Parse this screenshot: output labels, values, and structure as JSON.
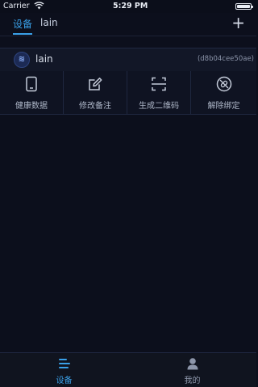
{
  "status_bar": {
    "carrier": "Carrier",
    "time": "5:29 PM"
  },
  "tabs": [
    {
      "label": "设备"
    },
    {
      "label": "lain"
    }
  ],
  "header": {
    "add_label": "+"
  },
  "device": {
    "avatar_text": "≋",
    "name": "lain",
    "id": "(d8b04cee50ae)"
  },
  "actions": [
    {
      "label": "健康数据",
      "icon": "tablet-icon"
    },
    {
      "label": "修改备注",
      "icon": "edit-icon"
    },
    {
      "label": "生成二维码",
      "icon": "scan-icon"
    },
    {
      "label": "解除绑定",
      "icon": "unbind-icon"
    }
  ],
  "bottom_nav": [
    {
      "label": "设备",
      "icon": "list-icon",
      "active": true
    },
    {
      "label": "我的",
      "icon": "user-icon",
      "active": false
    }
  ],
  "colors": {
    "accent": "#3aa0e8",
    "background": "#0c0f1c"
  }
}
